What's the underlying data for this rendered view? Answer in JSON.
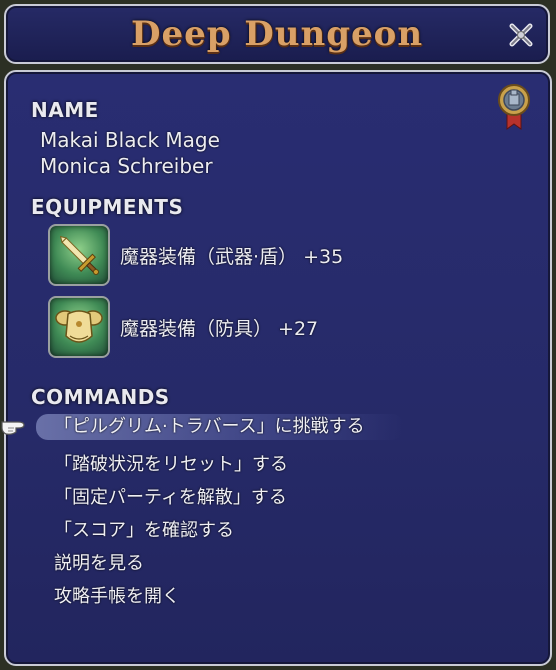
{
  "window": {
    "title": "Deep Dungeon"
  },
  "name_section": {
    "heading": "NAME",
    "line1": "Makai Black Mage",
    "line2": "Monica Schreiber"
  },
  "equipments_section": {
    "heading": "EQUIPMENTS",
    "items": [
      {
        "label": "魔器装備（武器·盾） +35",
        "icon": "sword-icon"
      },
      {
        "label": "魔器装備（防具） +27",
        "icon": "armor-icon"
      }
    ]
  },
  "commands_section": {
    "heading": "COMMANDS",
    "items": [
      "「ピルグリム·トラバース」に挑戦する",
      "「踏破状況をリセット」する",
      "「固定パーティを解散」する",
      "「スコア」を確認する",
      "説明を見る",
      "攻略手帳を開く"
    ],
    "selected_index": 0
  },
  "colors": {
    "panel_bg": "#272b6c",
    "title_text": "#d9a066",
    "border": "#c9cbd6"
  }
}
